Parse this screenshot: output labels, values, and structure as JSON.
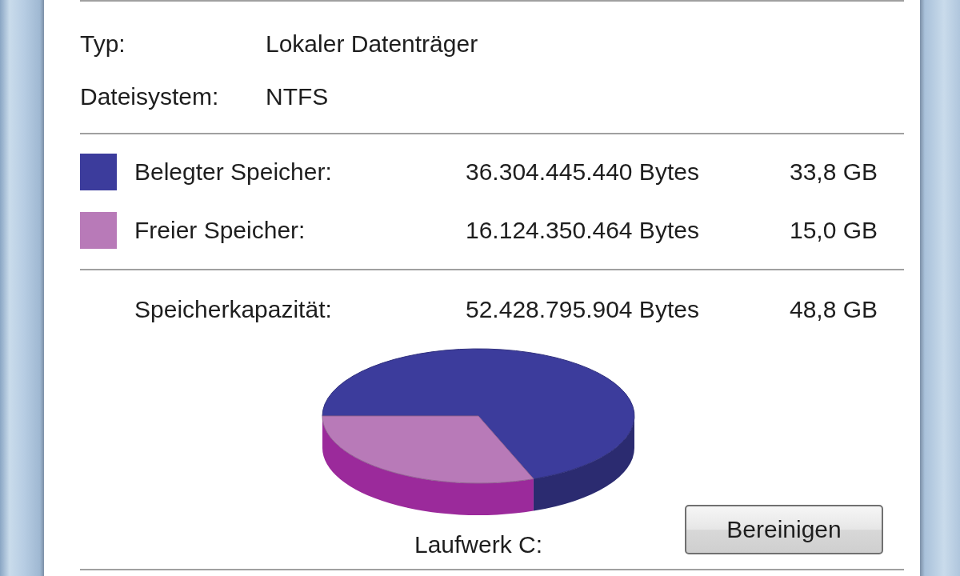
{
  "info_rows": [
    {
      "label": "Typ:",
      "value": "Lokaler Datenträger"
    },
    {
      "label": "Dateisystem:",
      "value": "NTFS"
    }
  ],
  "usage": [
    {
      "label": "Belegter Speicher:",
      "bytes": "36.304.445.440 Bytes",
      "size": "33,8 GB",
      "color": "#3c3c9c"
    },
    {
      "label": "Freier Speicher:",
      "bytes": "16.124.350.464 Bytes",
      "size": "15,0 GB",
      "color": "#b87ab8"
    }
  ],
  "capacity": {
    "label": "Speicherkapazität:",
    "bytes": "52.428.795.904 Bytes",
    "size": "48,8 GB"
  },
  "drive_label": "Laufwerk C:",
  "buttons": [
    {
      "label": "Bereinigen"
    }
  ]
}
